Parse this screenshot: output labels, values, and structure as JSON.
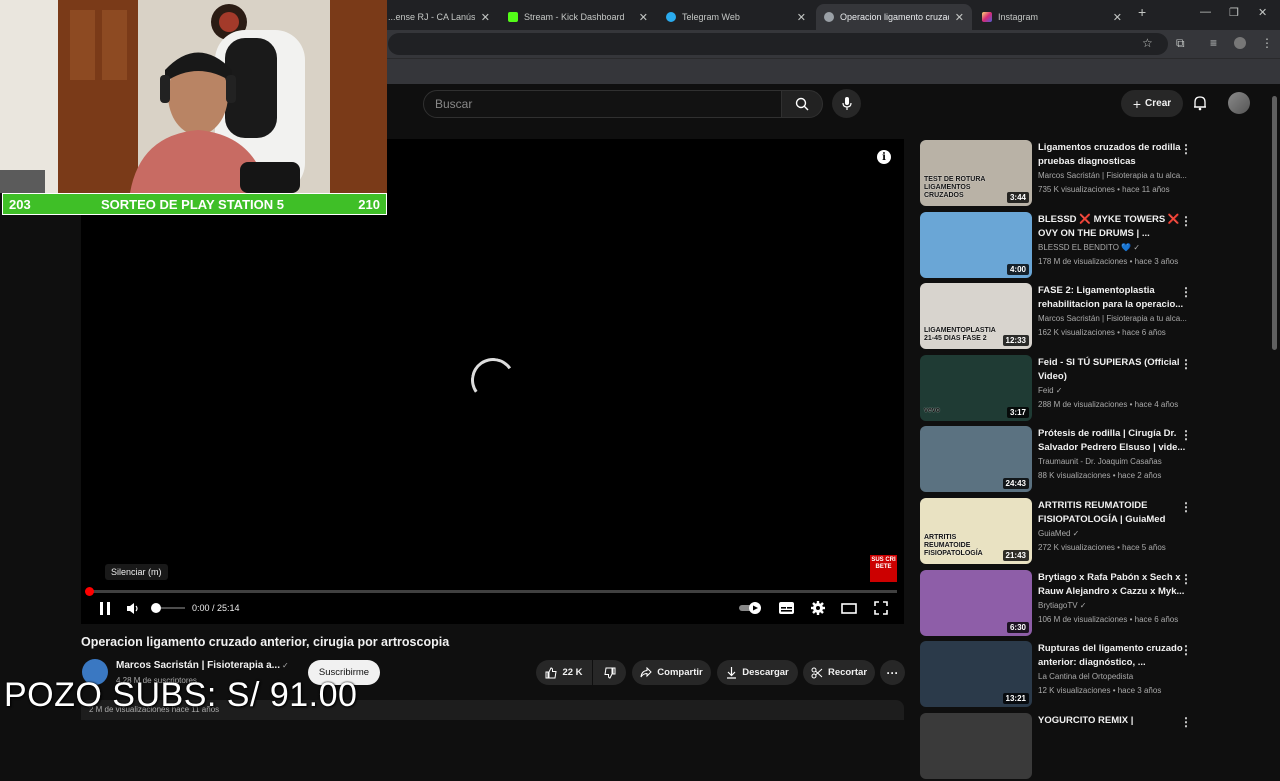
{
  "browser": {
    "tabs": [
      {
        "label": "...ense RJ - CA Lanús Cuot",
        "active": false,
        "color": "#888888"
      },
      {
        "label": "Stream - Kick Dashboard",
        "active": false,
        "color": "#53fc18"
      },
      {
        "label": "Telegram Web",
        "active": false,
        "color": "#2aabee"
      },
      {
        "label": "Operacion ligamento cruzado a...",
        "active": true,
        "color": "#9aa0a6"
      },
      {
        "label": "Instagram",
        "active": false,
        "color": "#e1306c"
      }
    ],
    "new_tab": "+",
    "window_controls": {
      "minimize": "—",
      "restore": "❐",
      "close": "✕"
    }
  },
  "header": {
    "search_placeholder": "Buscar",
    "create_label": "Crear"
  },
  "player": {
    "tooltip": "Silenciar (m)",
    "time": "0:00 / 25:14",
    "progress_fraction": 0.0,
    "volume_fraction": 0.15,
    "subscribe_badge": "SUS CRI BETE",
    "info": "i"
  },
  "webcam": {
    "left_number": "203",
    "title": "SORTEO DE PLAY STATION 5",
    "right_number": "210",
    "bar_color": "#3fbf27"
  },
  "video": {
    "title": "Operacion ligamento cruzado anterior, cirugia por artroscopia",
    "channel": "Marcos Sacristán | Fisioterapia a...",
    "subscribers": "4,28 M de suscriptores",
    "subscribe_label": "Suscribirme",
    "likes": "22 K",
    "share_label": "Compartir",
    "download_label": "Descargar",
    "clip_label": "Recortar",
    "description_stats": "2 M de visualizaciones  hace 11 años"
  },
  "overlay": {
    "pozo_text": "POZO SUBS: S/ 91.00"
  },
  "recommendations": [
    {
      "title": "Ligamentos cruzados de rodilla pruebas diagnosticas",
      "channel": "Marcos Sacristán | Fisioterapia a tu alca...",
      "meta": "735 K visualizaciones • hace 11 años",
      "duration": "3:44",
      "thumb_text": "TEST DE ROTURA LIGAMENTOS CRUZADOS",
      "bg": "#b9b2a6"
    },
    {
      "title": "BLESSD ❌ MYKE TOWERS ❌ OVY ON THE DRUMS | ...",
      "channel": "BLESSD EL BENDITO 💙 ✓",
      "meta": "178 M de visualizaciones • hace 3 años",
      "duration": "4:00",
      "thumb_text": "",
      "bg": "#6aa6d6"
    },
    {
      "title": "FASE 2: Ligamentoplastia rehabilitacion para la operacio...",
      "channel": "Marcos Sacristán | Fisioterapia a tu alca...",
      "meta": "162 K visualizaciones • hace 6 años",
      "duration": "12:33",
      "thumb_text": "LIGAMENTOPLASTIA 21-45 DIAS FASE 2",
      "bg": "#d8d4ce"
    },
    {
      "title": "Feid - SI TÚ SUPIERAS (Official Video)",
      "channel": "Feid ✓",
      "meta": "288 M de visualizaciones • hace 4 años",
      "duration": "3:17",
      "thumb_text": "vevo",
      "bg": "#1f3b34"
    },
    {
      "title": "Prótesis de rodilla | Cirugía Dr. Salvador Pedrero Elsuso | vide...",
      "channel": "Traumaunit - Dr. Joaquim Casañas",
      "meta": "88 K visualizaciones • hace 2 años",
      "duration": "24:43",
      "thumb_text": "",
      "bg": "#5b7281"
    },
    {
      "title": "ARTRITIS REUMATOIDE FISIOPATOLOGÍA | GuiaMed",
      "channel": "GuiaMed ✓",
      "meta": "272 K visualizaciones • hace 5 años",
      "duration": "21:43",
      "thumb_text": "ARTRITIS REUMATOIDE FISIOPATOLOGÍA",
      "bg": "#e9e2c2"
    },
    {
      "title": "Brytiago x Rafa Pabón x Sech x Rauw Alejandro x Cazzu x Myk...",
      "channel": "BrytiagoTV ✓",
      "meta": "106 M de visualizaciones • hace 6 años",
      "duration": "6:30",
      "thumb_text": "",
      "bg": "#8e5ea8"
    },
    {
      "title": "Rupturas del ligamento cruzado anterior: diagnóstico, ...",
      "channel": "La Cantina del Ortopedista",
      "meta": "12 K visualizaciones • hace 3 años",
      "duration": "13:21",
      "thumb_text": "",
      "bg": "#2b3a4a"
    },
    {
      "title": "YOGURCITO REMIX |",
      "channel": "",
      "meta": "",
      "duration": "",
      "thumb_text": "",
      "bg": "#3a3a3a"
    }
  ]
}
